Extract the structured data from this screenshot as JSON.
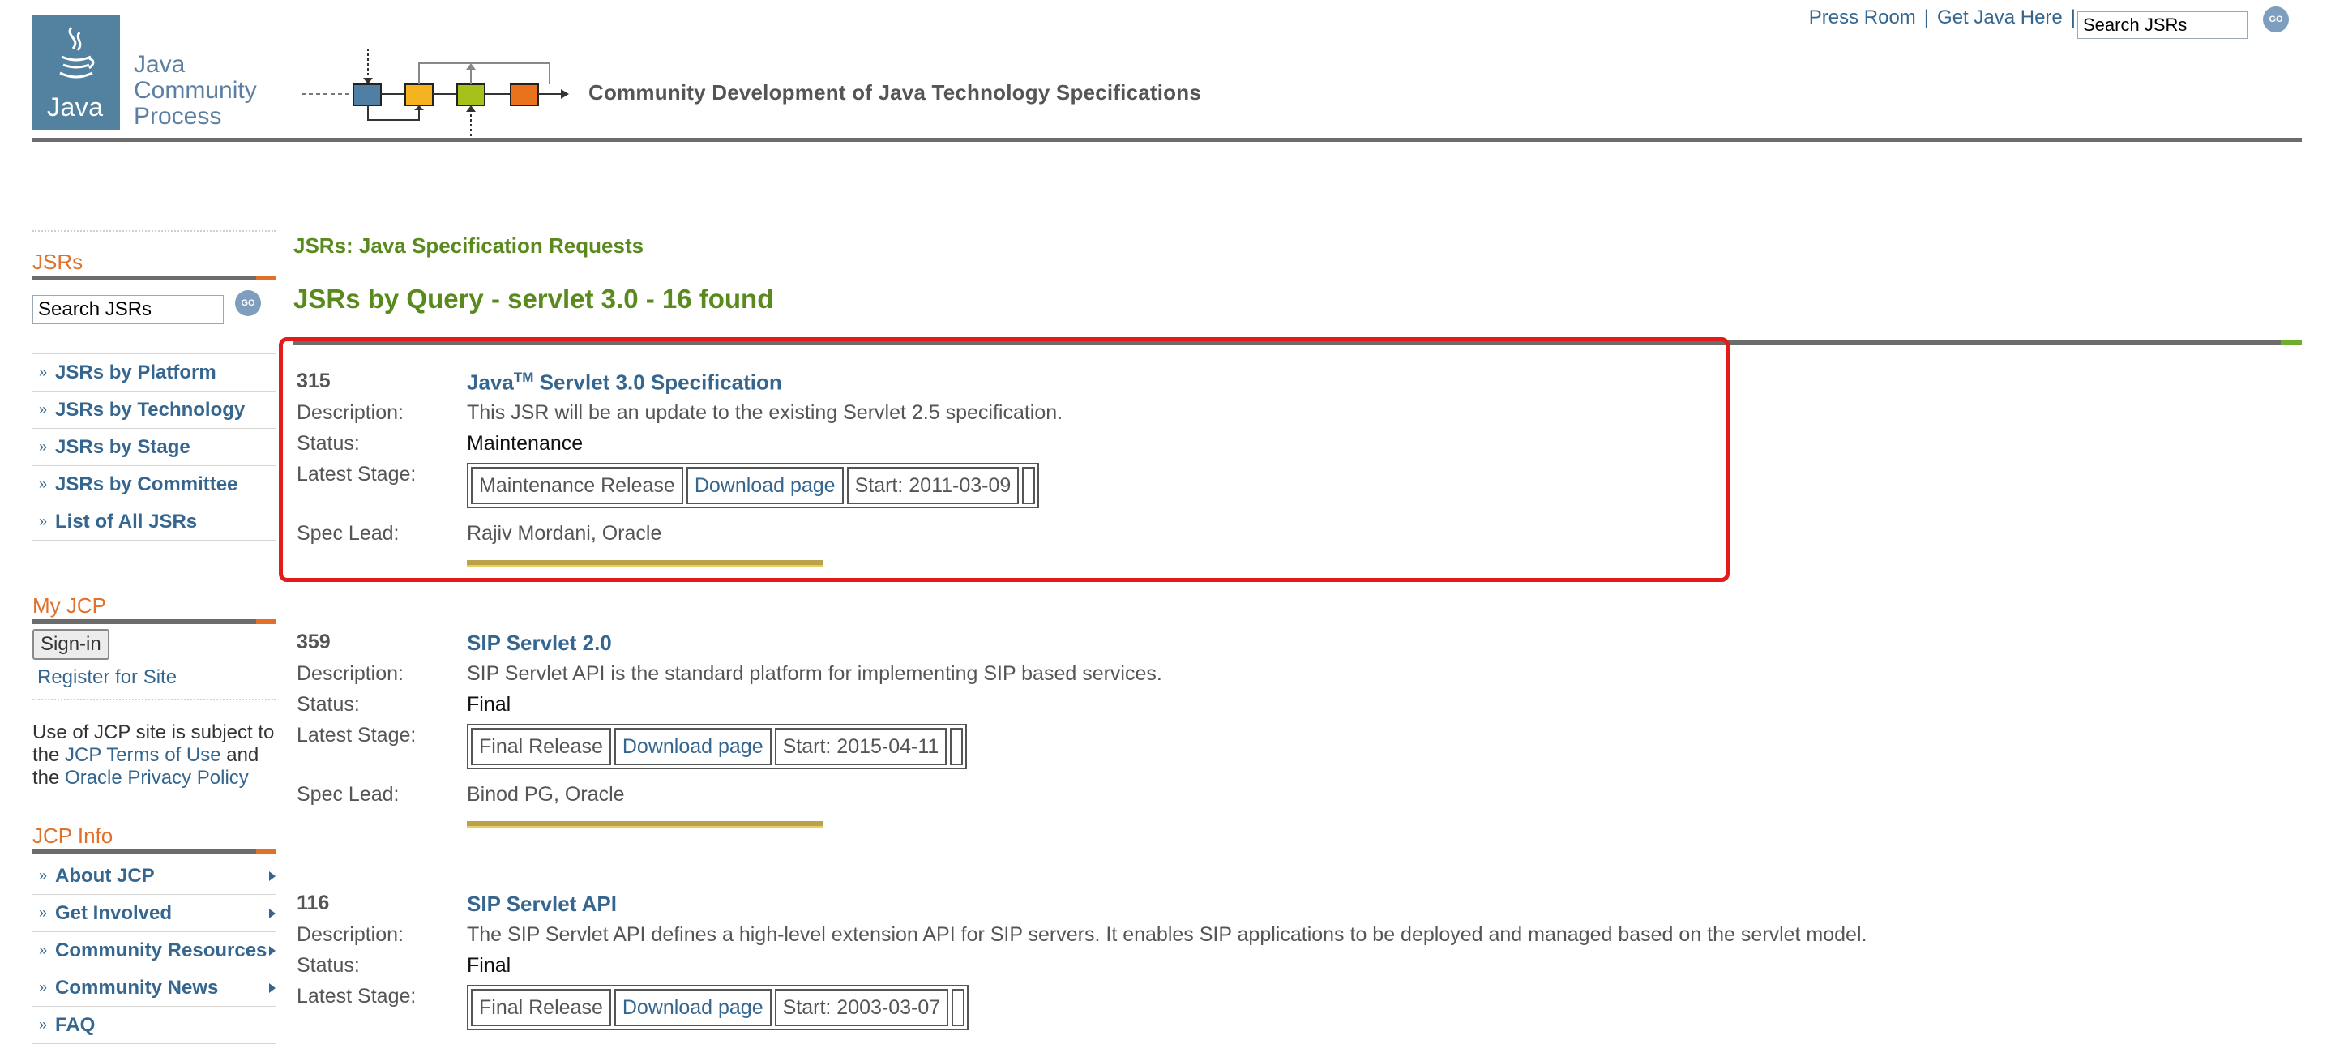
{
  "header": {
    "logo_text": "Java",
    "org_lines": [
      "Java",
      "Community",
      "Process"
    ],
    "tagline": "Community Development of Java Technology Specifications",
    "links": [
      "Press Room",
      "Get Java Here"
    ],
    "search_value": "Search JSRs",
    "go_label": "GO"
  },
  "sidebar": {
    "jsrs_heading": "JSRs",
    "search_value": "Search JSRs",
    "go_label": "GO",
    "nav": [
      "JSRs by Platform",
      "JSRs by Technology",
      "JSRs by Stage",
      "JSRs by Committee",
      "List of All JSRs"
    ],
    "myjcp_heading": "My JCP",
    "signin_label": "Sign-in",
    "register_label": "Register for Site",
    "terms": {
      "prefix": "Use of JCP site is subject to the",
      "terms_link": "JCP Terms of Use",
      "and": "and the",
      "privacy_link": "Oracle Privacy Policy"
    },
    "jcpinfo_heading": "JCP Info",
    "info_nav": [
      "About JCP",
      "Get Involved",
      "Community Resources",
      "Community News",
      "FAQ"
    ]
  },
  "main": {
    "breadcrumb": "JSRs: Java Specification Requests",
    "title": "JSRs by Query - servlet 3.0 - 16 found",
    "labels": {
      "description": "Description:",
      "status": "Status:",
      "latest_stage": "Latest Stage:",
      "spec_lead": "Spec Lead:"
    },
    "results": [
      {
        "number": "315",
        "title_pre": "Java",
        "title_sup": "TM",
        "title_post": " Servlet 3.0 Specification",
        "description": "This JSR will be an update to the existing Servlet 2.5 specification.",
        "status": "Maintenance",
        "stage": "Maintenance Release",
        "download": "Download page",
        "start": "Start: 2011-03-09",
        "spec_lead": "Rajiv Mordani, Oracle"
      },
      {
        "number": "359",
        "title": "SIP Servlet 2.0",
        "description": "SIP Servlet API is the standard platform for implementing SIP based services.",
        "status": "Final",
        "stage": "Final Release",
        "download": "Download page",
        "start": "Start: 2015-04-11",
        "spec_lead": "Binod PG, Oracle"
      },
      {
        "number": "116",
        "title": "SIP Servlet API",
        "description": "The SIP Servlet API defines a high-level extension API for SIP servers. It enables SIP applications to be deployed and managed based on the servlet model.",
        "status": "Final",
        "stage": "Final Release",
        "download": "Download page",
        "start": "Start: 2003-03-07"
      }
    ]
  },
  "colors": {
    "accent_orange": "#e0712b",
    "accent_green": "#5a8a1e",
    "link_blue": "#35668f",
    "highlight_red": "#e31b1b"
  }
}
